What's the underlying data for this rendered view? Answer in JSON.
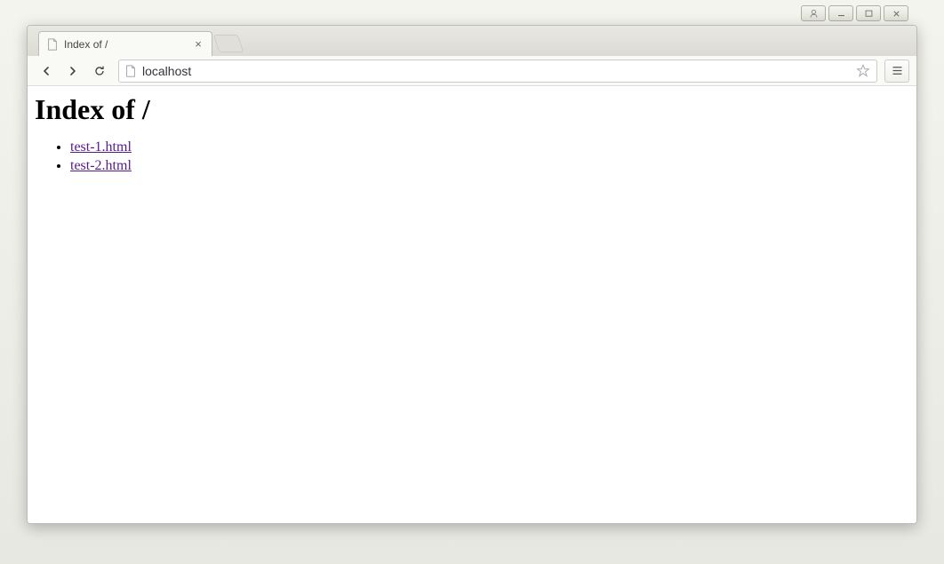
{
  "window": {
    "controls": {
      "user": "user",
      "minimize": "minimize",
      "maximize": "maximize",
      "close": "close"
    }
  },
  "browser": {
    "tab": {
      "title": "Index of /"
    },
    "address": {
      "url": "localhost"
    }
  },
  "page": {
    "heading": "Index of /",
    "links": [
      "test-1.html",
      "test-2.html"
    ]
  }
}
